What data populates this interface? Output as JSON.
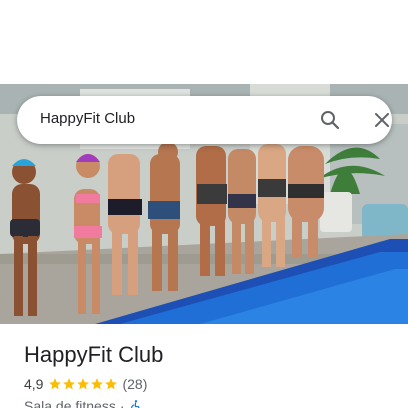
{
  "search": {
    "query": "HappyFit Club"
  },
  "icons": {
    "search": "search-icon",
    "close": "close-icon",
    "accessibility": "wheelchair-accessible-icon"
  },
  "place": {
    "name": "HappyFit Club",
    "rating": "4,9",
    "stars": 5,
    "review_count": "(28)",
    "category": "Sala de fitness",
    "separator": "·"
  },
  "colors": {
    "star": "#fbbc04",
    "accessibility": "#1a73e8",
    "pool": "#1f6fd6"
  }
}
